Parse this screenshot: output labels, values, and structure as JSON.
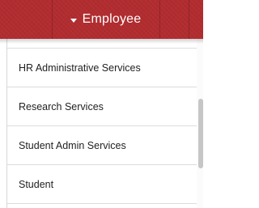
{
  "header": {
    "label": "Employee",
    "color": "#b12c2f",
    "caret_icon": "caret-down-icon"
  },
  "menu": {
    "items": [
      {
        "label": "HR Administrative Services"
      },
      {
        "label": "Research Services"
      },
      {
        "label": "Student Admin Services"
      },
      {
        "label": "Student"
      }
    ]
  }
}
